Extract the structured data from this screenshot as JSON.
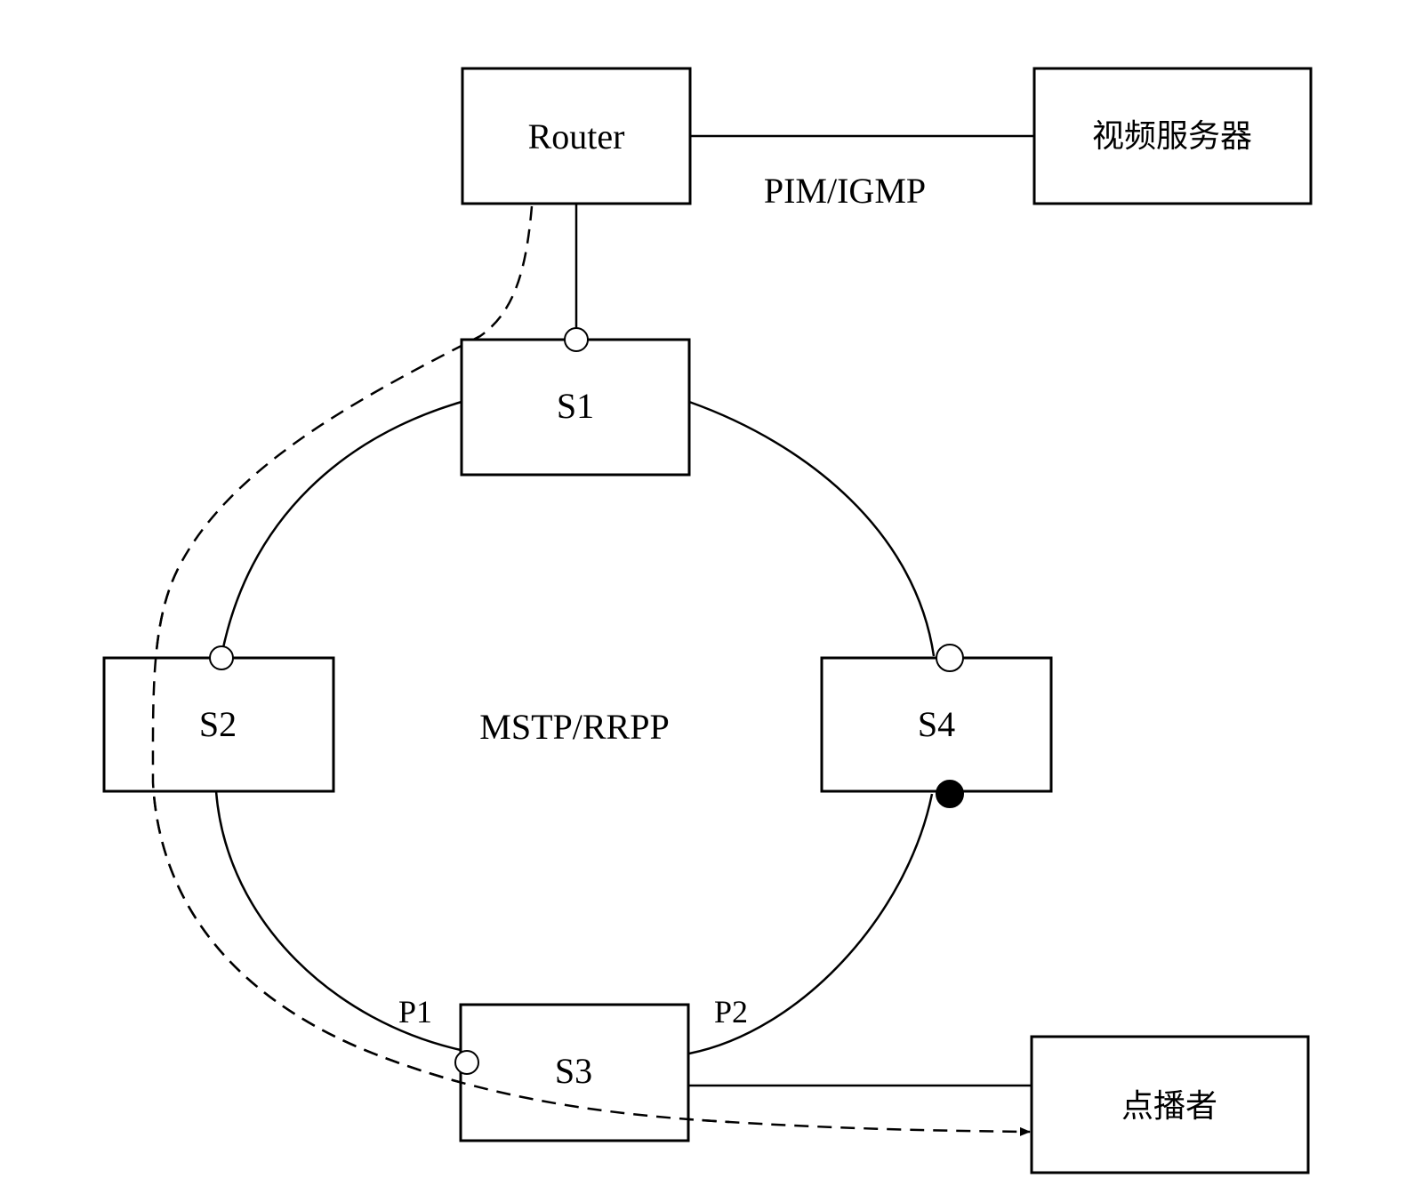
{
  "diagram": {
    "nodes": {
      "router": {
        "label": "Router"
      },
      "video_server": {
        "label": "视频服务器"
      },
      "s1": {
        "label": "S1"
      },
      "s2": {
        "label": "S2"
      },
      "s3": {
        "label": "S3"
      },
      "s4": {
        "label": "S4"
      },
      "viewer": {
        "label": "点播者"
      }
    },
    "protocols": {
      "upstream": "PIM/IGMP",
      "ring": "MSTP/RRPP"
    },
    "ports": {
      "p1": "P1",
      "p2": "P2"
    },
    "port_states": {
      "s1_top": "open",
      "s2_top": "open",
      "s4_top": "open",
      "s4_bottom": "blocked",
      "s3_p1": "open"
    },
    "edges": [
      {
        "from": "Router",
        "to": "视频服务器",
        "style": "solid"
      },
      {
        "from": "Router",
        "to": "S1",
        "style": "solid"
      },
      {
        "from": "S1",
        "to": "S2",
        "style": "solid"
      },
      {
        "from": "S1",
        "to": "S4",
        "style": "solid"
      },
      {
        "from": "S2",
        "to": "S3",
        "style": "solid",
        "port": "P1"
      },
      {
        "from": "S4",
        "to": "S3",
        "style": "solid",
        "port": "P2"
      },
      {
        "from": "S3",
        "to": "点播者",
        "style": "solid"
      },
      {
        "from": "Router",
        "to": "点播者",
        "style": "dashed",
        "via": [
          "S2",
          "S3"
        ],
        "arrow": true
      }
    ]
  }
}
